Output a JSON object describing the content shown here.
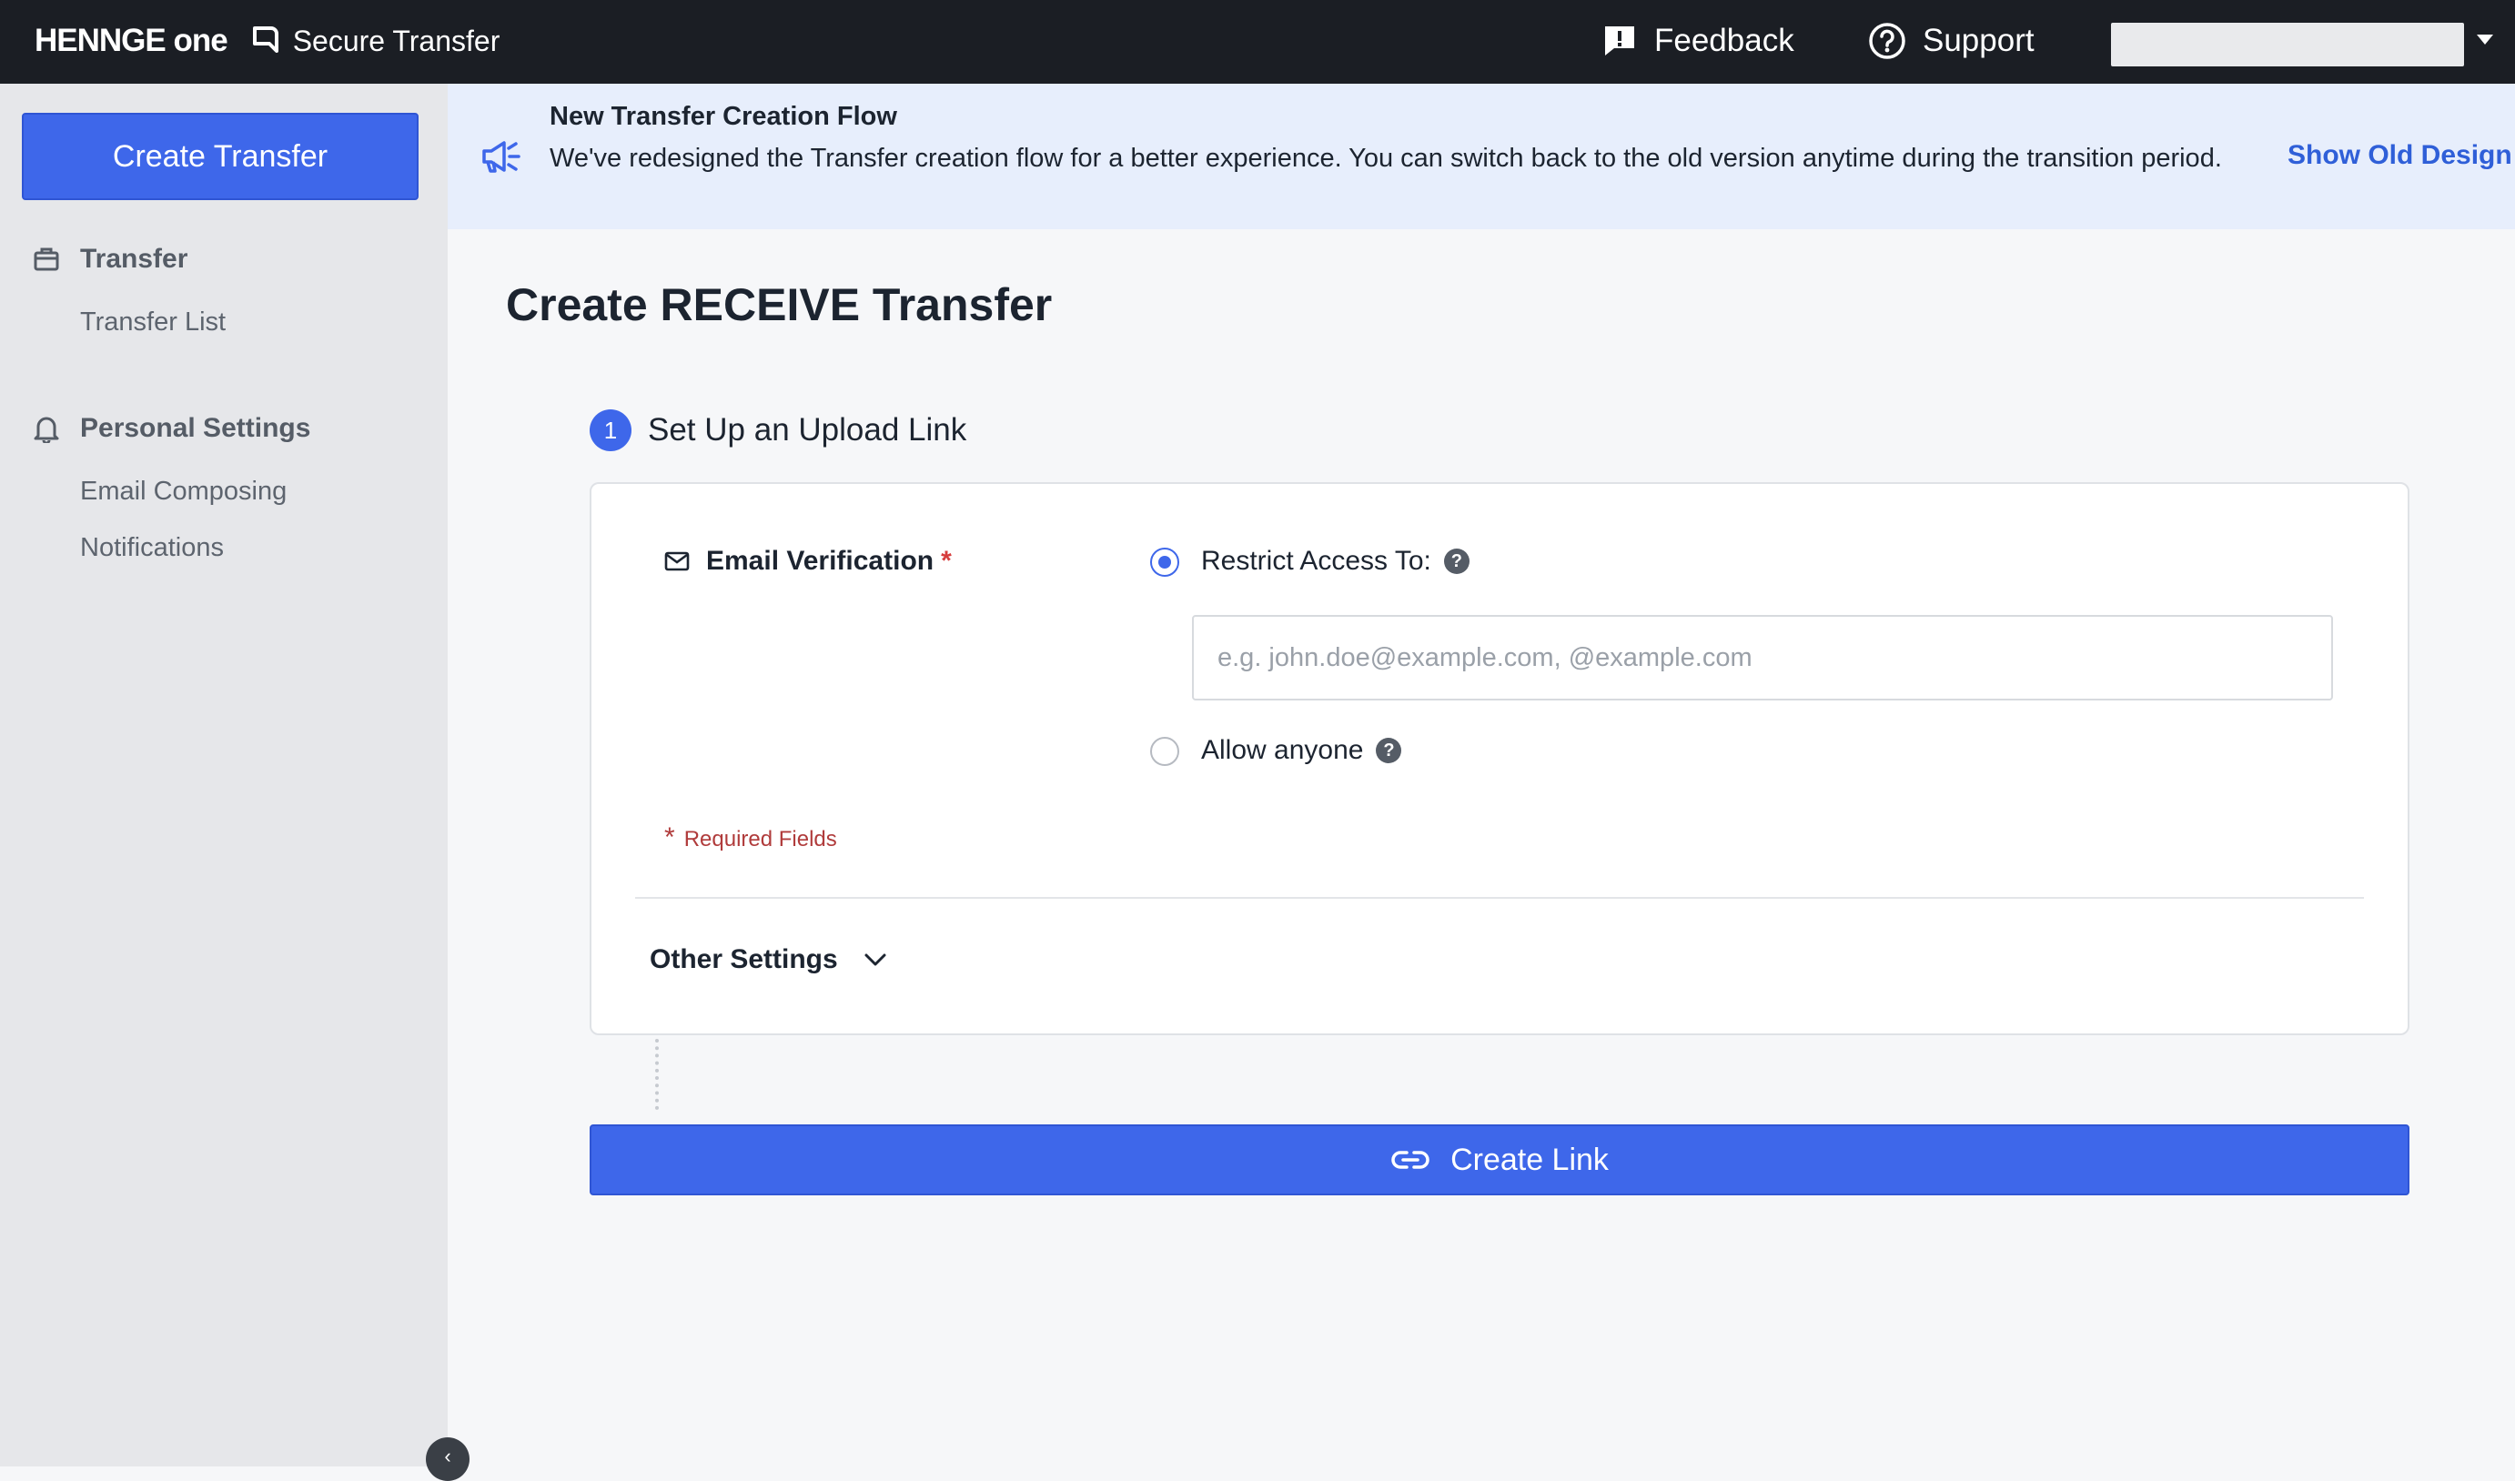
{
  "header": {
    "brand": "HENNGE one",
    "product": "Secure Transfer",
    "feedback_label": "Feedback",
    "support_label": "Support",
    "account_value": ""
  },
  "sidebar": {
    "create_label": "Create Transfer",
    "sections": [
      {
        "title": "Transfer",
        "icon": "briefcase-icon",
        "items": [
          "Transfer List"
        ]
      },
      {
        "title": "Personal Settings",
        "icon": "bell-icon",
        "items": [
          "Email Composing",
          "Notifications"
        ]
      }
    ]
  },
  "banner": {
    "title": "New Transfer Creation Flow",
    "text": "We've redesigned the Transfer creation flow for a better experience. You can switch back to the old version anytime during the transition period.",
    "link": "Show Old Design"
  },
  "main": {
    "page_title": "Create RECEIVE Transfer",
    "step_number": "1",
    "step_title": "Set Up an Upload Link",
    "field_label": "Email Verification",
    "required_mark": "*",
    "options": {
      "restrict_label": "Restrict Access To:",
      "restrict_placeholder": "e.g. john.doe@example.com, @example.com",
      "restrict_value": "",
      "anyone_label": "Allow anyone",
      "selected": "restrict"
    },
    "required_note": "Required Fields",
    "other_settings_label": "Other Settings",
    "create_link_label": "Create Link"
  },
  "colors": {
    "accent": "#3e67ea",
    "topbar": "#1b1e24",
    "sidebar": "#e6e7ea",
    "banner": "#e7eefc",
    "required": "#d63c3c"
  }
}
